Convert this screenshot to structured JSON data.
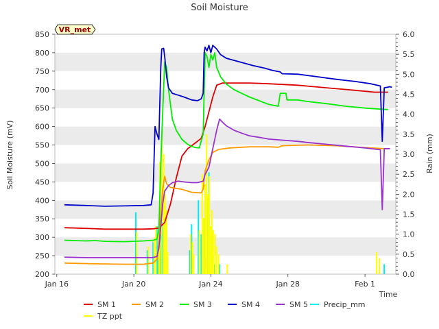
{
  "chart_data": {
    "type": "line",
    "title": "Soil Moisture",
    "xlabel": "Time",
    "ylabel_left": "Soil Moisture (mV)",
    "ylabel_right": "Rain (mm)",
    "annotation": "VR_met",
    "x_start": "Jan 16",
    "x_end_day_offset": 17.6,
    "x_ticks": [
      {
        "label": "Jan 16",
        "day": 0
      },
      {
        "label": "Jan 20",
        "day": 4
      },
      {
        "label": "Jan 24",
        "day": 8
      },
      {
        "label": "Jan 28",
        "day": 12
      },
      {
        "label": "Feb 1",
        "day": 16
      }
    ],
    "ylim_left": [
      200,
      850
    ],
    "ylim_right": [
      0,
      6
    ],
    "yticks_left": [
      200,
      250,
      300,
      350,
      400,
      450,
      500,
      550,
      600,
      650,
      700,
      750,
      800,
      850
    ],
    "yticks_right": [
      "0.0",
      "0.5",
      "1.0",
      "1.5",
      "2.0",
      "2.5",
      "3.0",
      "3.5",
      "4.0",
      "4.5",
      "5.0",
      "5.5",
      "6.0"
    ],
    "grid": "horizontal bands",
    "legend_position": "bottom",
    "series": [
      {
        "name": "SM 1",
        "axis": "left",
        "color": "#dd0000",
        "points": [
          [
            0.4,
            326
          ],
          [
            1.5,
            324
          ],
          [
            2.5,
            322
          ],
          [
            3.5,
            322
          ],
          [
            4.5,
            322
          ],
          [
            5.0,
            323
          ],
          [
            5.3,
            325
          ],
          [
            5.6,
            340
          ],
          [
            5.9,
            390
          ],
          [
            6.2,
            460
          ],
          [
            6.5,
            520
          ],
          [
            6.8,
            540
          ],
          [
            7.0,
            548
          ],
          [
            7.3,
            560
          ],
          [
            7.5,
            568
          ],
          [
            7.7,
            600
          ],
          [
            7.9,
            640
          ],
          [
            8.1,
            680
          ],
          [
            8.3,
            712
          ],
          [
            8.6,
            718
          ],
          [
            10.0,
            718
          ],
          [
            11.0,
            716
          ],
          [
            12.5,
            712
          ],
          [
            14.0,
            705
          ],
          [
            15.5,
            698
          ],
          [
            16.5,
            693
          ],
          [
            17.2,
            693
          ]
        ]
      },
      {
        "name": "SM 2",
        "axis": "left",
        "color": "#ff9900",
        "points": [
          [
            0.4,
            230
          ],
          [
            2.0,
            228
          ],
          [
            3.5,
            227
          ],
          [
            4.5,
            227
          ],
          [
            5.0,
            230
          ],
          [
            5.2,
            240
          ],
          [
            5.3,
            280
          ],
          [
            5.4,
            360
          ],
          [
            5.5,
            430
          ],
          [
            5.6,
            465
          ],
          [
            5.7,
            445
          ],
          [
            5.9,
            435
          ],
          [
            6.5,
            430
          ],
          [
            7.0,
            422
          ],
          [
            7.5,
            420
          ],
          [
            7.6,
            430
          ],
          [
            7.7,
            480
          ],
          [
            7.9,
            510
          ],
          [
            8.1,
            530
          ],
          [
            8.4,
            538
          ],
          [
            9.0,
            542
          ],
          [
            10.0,
            545
          ],
          [
            11.0,
            545
          ],
          [
            11.5,
            544
          ],
          [
            11.7,
            548
          ],
          [
            13.0,
            550
          ],
          [
            14.5,
            548
          ],
          [
            16.0,
            543
          ],
          [
            17.0,
            540
          ],
          [
            17.2,
            540
          ]
        ]
      },
      {
        "name": "SM 3",
        "axis": "left",
        "color": "#00ee00",
        "points": [
          [
            0.4,
            292
          ],
          [
            1.5,
            290
          ],
          [
            2.0,
            291
          ],
          [
            2.5,
            289
          ],
          [
            3.5,
            288
          ],
          [
            4.5,
            290
          ],
          [
            5.0,
            292
          ],
          [
            5.2,
            295
          ],
          [
            5.3,
            320
          ],
          [
            5.4,
            500
          ],
          [
            5.5,
            640
          ],
          [
            5.6,
            775
          ],
          [
            5.7,
            760
          ],
          [
            5.8,
            700
          ],
          [
            6.0,
            620
          ],
          [
            6.2,
            590
          ],
          [
            6.5,
            565
          ],
          [
            6.8,
            552
          ],
          [
            7.0,
            546
          ],
          [
            7.2,
            543
          ],
          [
            7.4,
            542
          ],
          [
            7.6,
            580
          ],
          [
            7.7,
            800
          ],
          [
            7.8,
            790
          ],
          [
            7.9,
            760
          ],
          [
            8.0,
            795
          ],
          [
            8.1,
            780
          ],
          [
            8.2,
            800
          ],
          [
            8.3,
            760
          ],
          [
            8.5,
            735
          ],
          [
            8.8,
            715
          ],
          [
            9.2,
            700
          ],
          [
            9.6,
            690
          ],
          [
            10.0,
            680
          ],
          [
            10.5,
            670
          ],
          [
            11.0,
            660
          ],
          [
            11.5,
            655
          ],
          [
            11.6,
            690
          ],
          [
            11.9,
            690
          ],
          [
            11.95,
            672
          ],
          [
            12.5,
            672
          ],
          [
            13.0,
            668
          ],
          [
            14.0,
            662
          ],
          [
            15.0,
            655
          ],
          [
            16.0,
            650
          ],
          [
            16.6,
            648
          ],
          [
            17.2,
            646
          ]
        ]
      },
      {
        "name": "SM 4",
        "axis": "left",
        "color": "#0000cc",
        "points": [
          [
            0.4,
            388
          ],
          [
            1.5,
            386
          ],
          [
            2.5,
            384
          ],
          [
            3.5,
            385
          ],
          [
            4.5,
            386
          ],
          [
            4.9,
            388
          ],
          [
            5.0,
            420
          ],
          [
            5.1,
            600
          ],
          [
            5.2,
            580
          ],
          [
            5.3,
            565
          ],
          [
            5.4,
            760
          ],
          [
            5.45,
            810
          ],
          [
            5.55,
            812
          ],
          [
            5.6,
            790
          ],
          [
            5.7,
            735
          ],
          [
            5.8,
            705
          ],
          [
            6.0,
            690
          ],
          [
            6.3,
            685
          ],
          [
            6.6,
            680
          ],
          [
            7.0,
            672
          ],
          [
            7.3,
            670
          ],
          [
            7.5,
            675
          ],
          [
            7.6,
            690
          ],
          [
            7.65,
            800
          ],
          [
            7.7,
            815
          ],
          [
            7.8,
            805
          ],
          [
            7.9,
            820
          ],
          [
            8.0,
            800
          ],
          [
            8.1,
            820
          ],
          [
            8.3,
            810
          ],
          [
            8.5,
            795
          ],
          [
            8.8,
            785
          ],
          [
            9.5,
            775
          ],
          [
            10.2,
            765
          ],
          [
            10.8,
            758
          ],
          [
            11.2,
            752
          ],
          [
            11.6,
            748
          ],
          [
            11.7,
            743
          ],
          [
            12.5,
            742
          ],
          [
            13.5,
            735
          ],
          [
            14.5,
            728
          ],
          [
            15.5,
            722
          ],
          [
            16.3,
            716
          ],
          [
            16.8,
            710
          ],
          [
            16.9,
            560
          ],
          [
            17.0,
            705
          ],
          [
            17.3,
            708
          ],
          [
            17.4,
            706
          ]
        ]
      },
      {
        "name": "SM 5",
        "axis": "left",
        "color": "#9933cc",
        "points": [
          [
            0.4,
            246
          ],
          [
            1.5,
            245
          ],
          [
            2.5,
            245
          ],
          [
            3.5,
            245
          ],
          [
            4.5,
            245
          ],
          [
            5.0,
            245
          ],
          [
            5.2,
            248
          ],
          [
            5.3,
            270
          ],
          [
            5.4,
            330
          ],
          [
            5.5,
            390
          ],
          [
            5.6,
            425
          ],
          [
            5.8,
            440
          ],
          [
            6.0,
            448
          ],
          [
            6.3,
            452
          ],
          [
            6.6,
            450
          ],
          [
            7.0,
            448
          ],
          [
            7.3,
            448
          ],
          [
            7.6,
            452
          ],
          [
            7.7,
            470
          ],
          [
            7.9,
            490
          ],
          [
            8.1,
            540
          ],
          [
            8.3,
            590
          ],
          [
            8.45,
            620
          ],
          [
            8.6,
            612
          ],
          [
            8.8,
            602
          ],
          [
            9.2,
            590
          ],
          [
            9.6,
            582
          ],
          [
            10.0,
            575
          ],
          [
            10.6,
            570
          ],
          [
            11.0,
            566
          ],
          [
            11.5,
            564
          ],
          [
            12.5,
            560
          ],
          [
            13.0,
            557
          ],
          [
            14.0,
            552
          ],
          [
            15.0,
            547
          ],
          [
            16.0,
            542
          ],
          [
            16.8,
            537
          ],
          [
            16.9,
            375
          ],
          [
            17.0,
            540
          ],
          [
            17.3,
            540
          ]
        ]
      },
      {
        "name": "Precip_mm",
        "axis": "right",
        "color": "#00eeee",
        "style": "bars",
        "points": [
          [
            4.1,
            1.55
          ],
          [
            4.7,
            0.6
          ],
          [
            5.0,
            0.8
          ],
          [
            5.2,
            1.2
          ],
          [
            5.25,
            0.7
          ],
          [
            5.4,
            1.0
          ],
          [
            5.5,
            1.3
          ],
          [
            6.9,
            0.6
          ],
          [
            7.0,
            1.25
          ],
          [
            7.35,
            1.85
          ],
          [
            7.5,
            1.0
          ],
          [
            7.65,
            1.4
          ],
          [
            7.8,
            1.9
          ],
          [
            7.9,
            2.55
          ],
          [
            8.05,
            1.0
          ],
          [
            8.2,
            0.25
          ],
          [
            8.45,
            0.25
          ],
          [
            17.0,
            0.25
          ]
        ]
      },
      {
        "name": "TZ ppt",
        "axis": "right",
        "color": "#ffff00",
        "style": "bars",
        "points": [
          [
            4.15,
            1.05
          ],
          [
            4.75,
            0.7
          ],
          [
            5.05,
            0.9
          ],
          [
            5.15,
            1.2
          ],
          [
            5.3,
            1.05
          ],
          [
            5.35,
            2.8
          ],
          [
            5.45,
            3.6
          ],
          [
            5.55,
            3.0
          ],
          [
            5.62,
            2.0
          ],
          [
            5.7,
            1.6
          ],
          [
            5.75,
            0.55
          ],
          [
            6.95,
            1.0
          ],
          [
            7.05,
            0.8
          ],
          [
            7.1,
            0.5
          ],
          [
            7.4,
            1.1
          ],
          [
            7.55,
            2.5
          ],
          [
            7.62,
            1.4
          ],
          [
            7.7,
            2.25
          ],
          [
            7.78,
            3.5
          ],
          [
            7.85,
            2.0
          ],
          [
            7.92,
            2.45
          ],
          [
            7.98,
            1.2
          ],
          [
            8.05,
            1.6
          ],
          [
            8.12,
            1.1
          ],
          [
            8.22,
            1.0
          ],
          [
            8.3,
            0.7
          ],
          [
            8.4,
            0.5
          ],
          [
            8.85,
            0.25
          ],
          [
            16.6,
            0.55
          ],
          [
            16.75,
            0.4
          ]
        ]
      }
    ]
  }
}
